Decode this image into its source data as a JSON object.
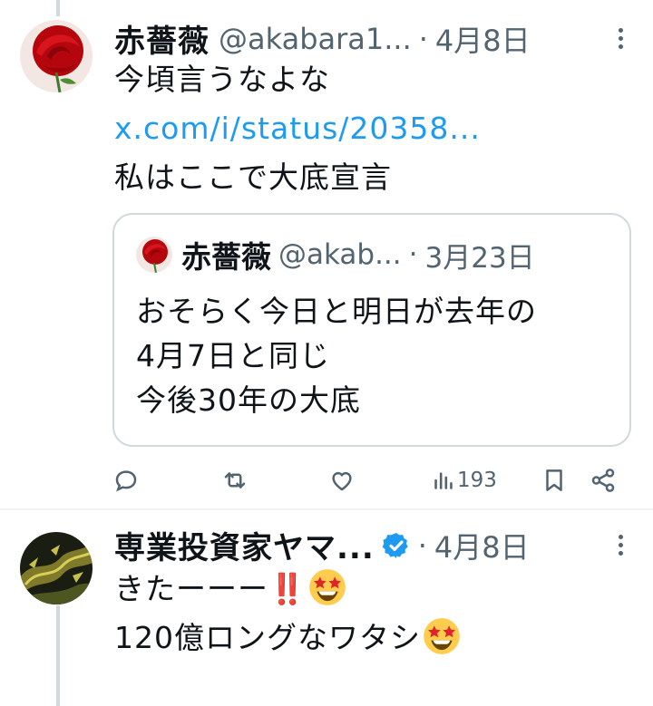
{
  "post1": {
    "author_name": "赤薔薇",
    "handle": "@akabara1...",
    "date": "4月8日",
    "line1": "今頃言うなよな",
    "link": "x.com/i/status/20358...",
    "line3": "私はここで大底宣言",
    "quote": {
      "author_name": "赤薔薇",
      "handle": "@akab...",
      "date": "3月23日",
      "line1": "おそらく今日と明日が去年の",
      "line2": "4月7日と同じ",
      "line3": "今後30年の大底"
    },
    "actions": {
      "views_count": "193"
    }
  },
  "post2": {
    "author_name": "専業投資家ヤマ...",
    "date": "4月8日",
    "line1": "きたーーー",
    "line1_mark": "‼️",
    "line2": "120億ロングなワタシ"
  },
  "icons": [
    "reply-icon",
    "repost-icon",
    "like-icon",
    "views-icon",
    "bookmark-icon",
    "share-icon",
    "more-icon",
    "verified-badge-icon",
    "star-struck-emoji"
  ],
  "colors": {
    "link": "#1d9bf0",
    "muted": "#536471",
    "border": "#cfd9de",
    "verified": "#1d9bf0"
  }
}
